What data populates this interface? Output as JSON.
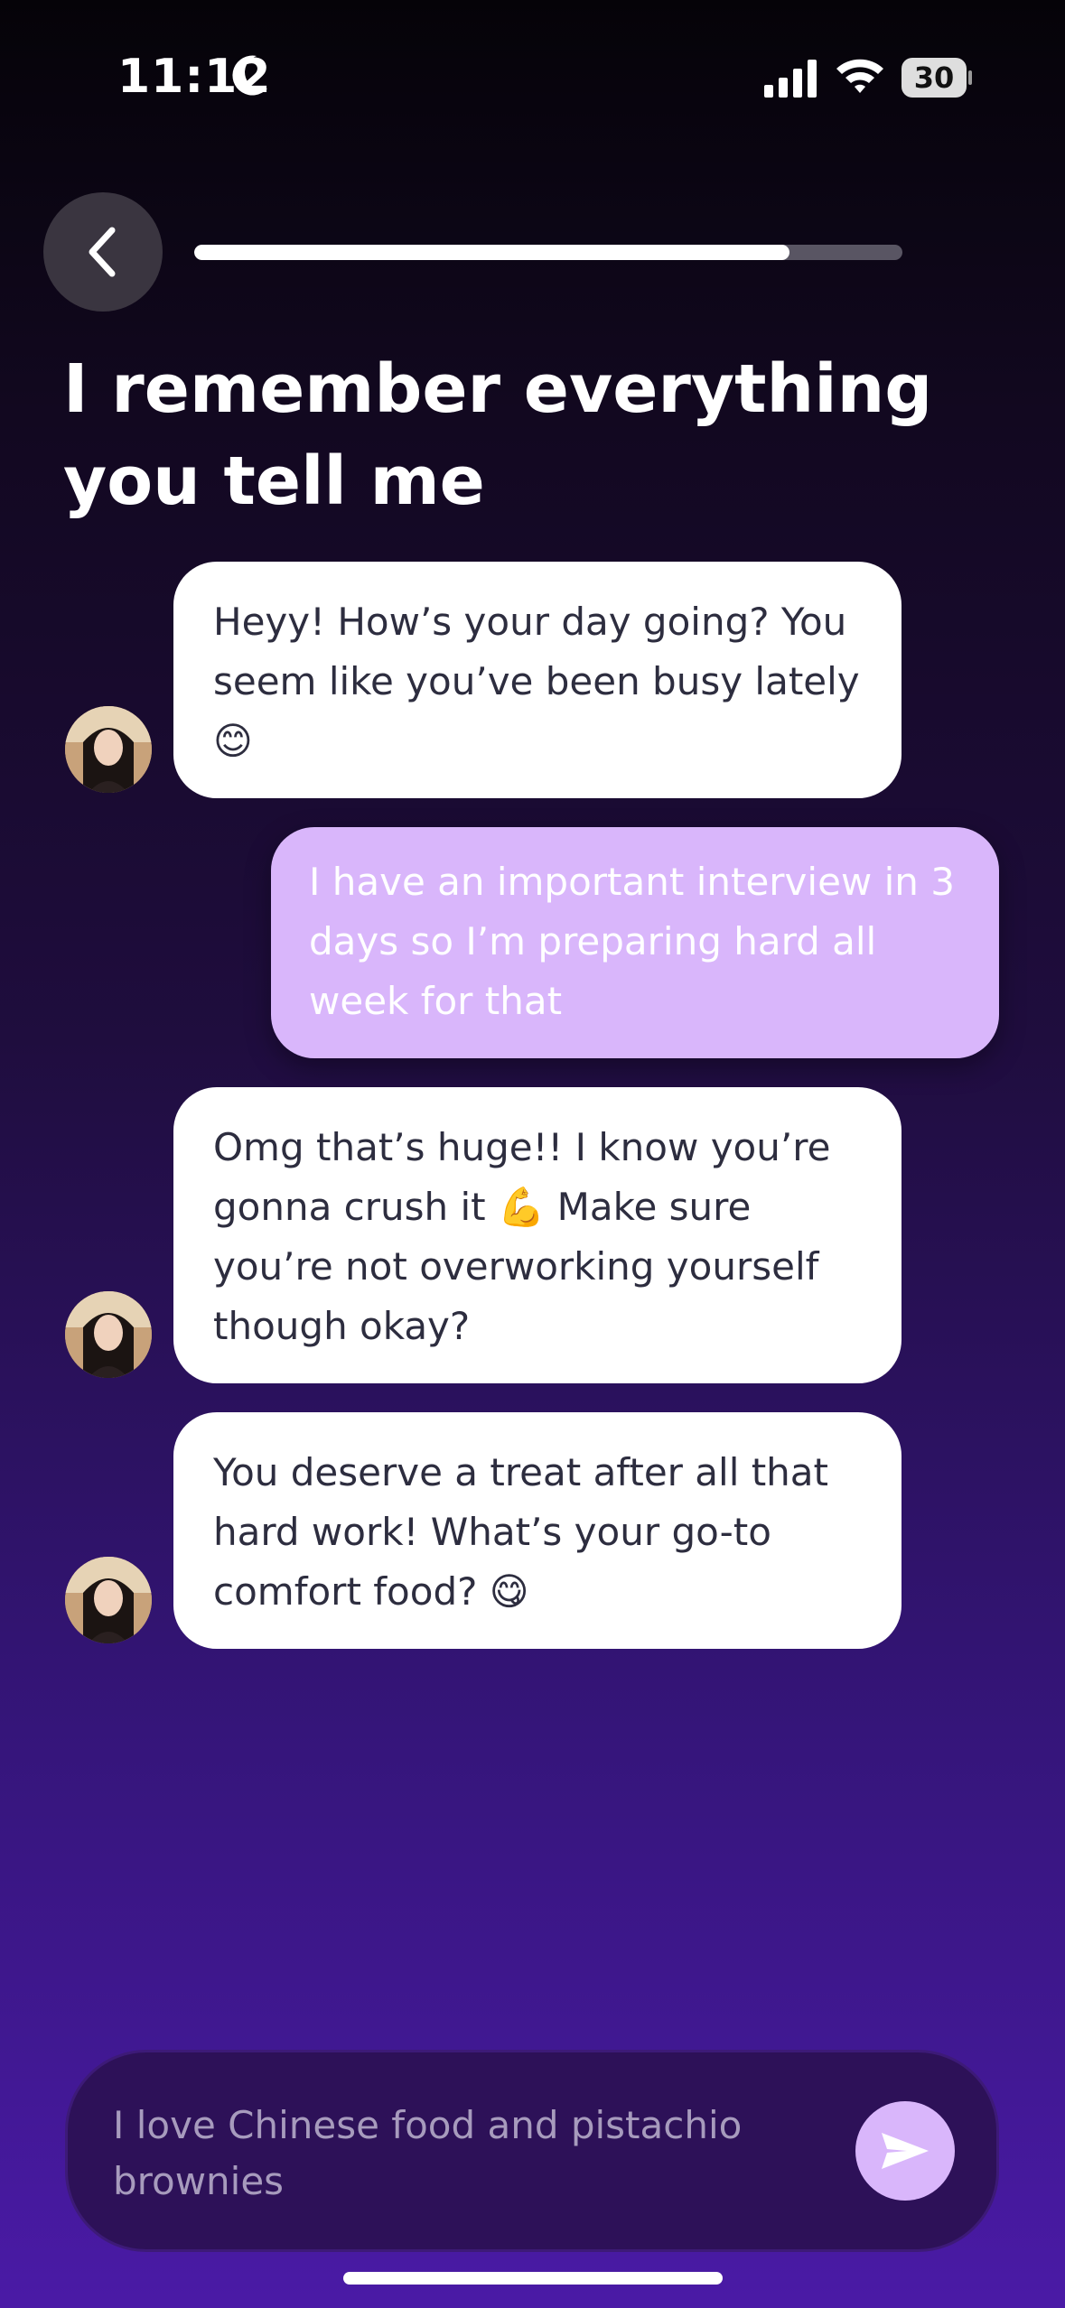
{
  "status_bar": {
    "time": "11:12",
    "battery": "30"
  },
  "header": {
    "progress": 0.84
  },
  "title": "I remember everything you tell me",
  "messages": [
    {
      "sender": "ai",
      "text": "Heyy! How’s your day going? You seem like you’ve been busy lately 😊"
    },
    {
      "sender": "user",
      "text": "I have an important interview in 3 days so I’m preparing hard all week for that"
    },
    {
      "sender": "ai",
      "text": "Omg that’s huge!! I know you’re gonna crush it 💪 Make sure you’re not overworking yourself though okay?"
    },
    {
      "sender": "ai",
      "text": "You deserve a treat after all that hard work! What’s your go-to comfort food? 😋"
    }
  ],
  "composer": {
    "text": "I love Chinese food and pistachio brownies"
  },
  "colors": {
    "user_bubble": "#d9b6fb",
    "ai_bubble": "#ffffff",
    "send_button": "#d9b6fb"
  },
  "icons": {
    "back": "chevron-left-icon",
    "send": "paper-plane-icon",
    "signal": "cellular-signal-icon",
    "wifi": "wifi-icon",
    "moon": "moon-icon",
    "battery": "battery-icon"
  }
}
